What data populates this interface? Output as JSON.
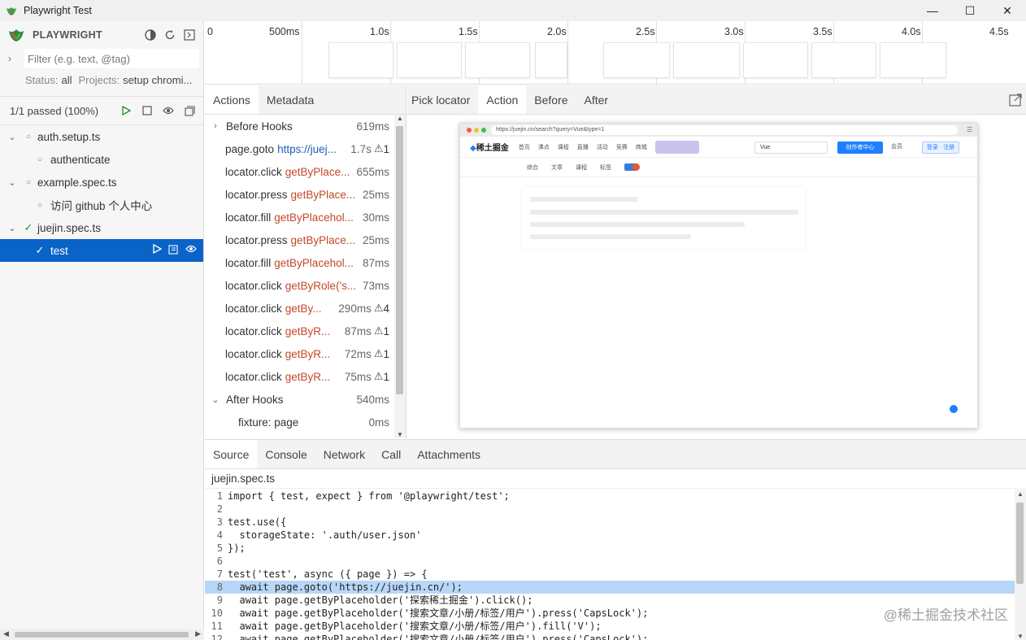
{
  "window": {
    "title": "Playwright Test",
    "minimize": "—",
    "maximize": "☐",
    "close": "✕"
  },
  "sidebar": {
    "brand": "PLAYWRIGHT",
    "filter_placeholder": "Filter (e.g. text, @tag)",
    "status_label": "Status:",
    "status_value": "all",
    "projects_label": "Projects:",
    "projects_value": "setup chromi...",
    "passed": "1/1 passed (100%)",
    "tree": [
      {
        "label": "auth.setup.ts"
      },
      {
        "label": "authenticate"
      },
      {
        "label": "example.spec.ts"
      },
      {
        "label": "访问 github 个人中心"
      },
      {
        "label": "juejin.spec.ts"
      },
      {
        "label": "test"
      }
    ]
  },
  "timeline": {
    "labels": [
      "0",
      "500ms",
      "1.0s",
      "1.5s",
      "2.0s",
      "2.5s",
      "3.0s",
      "3.5s",
      "4.0s",
      "4.5s"
    ]
  },
  "actions_panel": {
    "tabs": [
      "Actions",
      "Metadata"
    ],
    "items": [
      {
        "name": "Before Hooks",
        "time": "619ms"
      },
      {
        "name": "page.goto",
        "arg": "https://juej...",
        "time": "1.7s",
        "warn": "1"
      },
      {
        "name": "locator.click",
        "arg": "getByPlace...",
        "time": "655ms"
      },
      {
        "name": "locator.press",
        "arg": "getByPlace...",
        "time": "25ms"
      },
      {
        "name": "locator.fill",
        "arg": "getByPlacehol...",
        "time": "30ms"
      },
      {
        "name": "locator.press",
        "arg": "getByPlace...",
        "time": "25ms"
      },
      {
        "name": "locator.fill",
        "arg": "getByPlacehol...",
        "time": "87ms"
      },
      {
        "name": "locator.click",
        "arg": "getByRole('s...",
        "time": "73ms"
      },
      {
        "name": "locator.click",
        "arg": "getBy...",
        "time": "290ms",
        "warn": "4"
      },
      {
        "name": "locator.click",
        "arg": "getByR...",
        "time": "87ms",
        "warn": "1"
      },
      {
        "name": "locator.click",
        "arg": "getByR...",
        "time": "72ms",
        "warn": "1"
      },
      {
        "name": "locator.click",
        "arg": "getByR...",
        "time": "75ms",
        "warn": "1"
      },
      {
        "name": "After Hooks",
        "time": "540ms"
      },
      {
        "name": "fixture: page",
        "time": "0ms"
      }
    ]
  },
  "snapshot": {
    "tabs": [
      "Pick locator",
      "Action",
      "Before",
      "After"
    ],
    "url": "https://juejin.cn/search?query=Vue&type=1",
    "logo_text": "稀土掘金",
    "nav_links": [
      "首页",
      "沸点",
      "课程",
      "直播",
      "活动",
      "竞赛",
      "商城"
    ],
    "search_value": "Vue",
    "create_label": "创作者中心",
    "vip_label": "会员",
    "login_label": "登录 · 注册",
    "sub_links": [
      "综合",
      "文章",
      "课程",
      "标签"
    ]
  },
  "bottom_panel": {
    "tabs": [
      "Source",
      "Console",
      "Network",
      "Call",
      "Attachments"
    ],
    "file_name": "juejin.spec.ts",
    "code_lines": [
      "import { test, expect } from '@playwright/test';",
      "",
      "test.use({",
      "  storageState: '.auth/user.json'",
      "});",
      "",
      "test('test', async ({ page }) => {",
      "  await page.goto('https://juejin.cn/');",
      "  await page.getByPlaceholder('探索稀土掘金').click();",
      "  await page.getByPlaceholder('搜索文章/小册/标签/用户').press('CapsLock');",
      "  await page.getByPlaceholder('搜索文章/小册/标签/用户').fill('V');",
      "  await page.getByPlaceholder('搜索文章/小册/标签/用户').press('CapsLock');"
    ],
    "highlighted_line": 8
  },
  "watermark": "@稀土掘金技术社区"
}
